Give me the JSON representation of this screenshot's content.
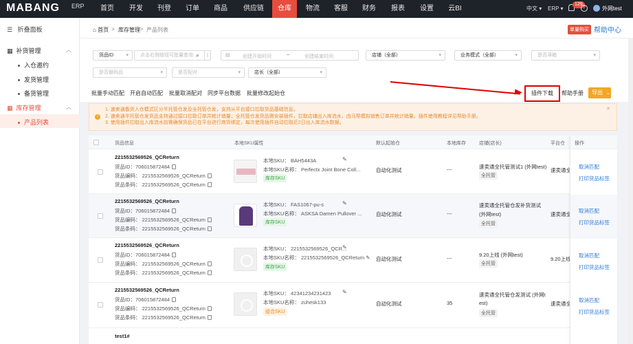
{
  "brand": {
    "logo": "MABANG",
    "erp": "ERP"
  },
  "nav": [
    "首页",
    "开发",
    "刊登",
    "订单",
    "商品",
    "供应链",
    "仓库",
    "物流",
    "客服",
    "财务",
    "报表",
    "设置",
    "云BI"
  ],
  "topright": {
    "lang": "中文",
    "erp": "ERP",
    "badge": "129",
    "user": "外网test"
  },
  "sidebar": {
    "fold": "折叠面板",
    "groups": [
      {
        "label": "补货管理",
        "items": [
          "入仓邀约",
          "发货管理",
          "备货管理"
        ]
      },
      {
        "label": "库存管理",
        "items": [
          "产品列表"
        ]
      }
    ]
  },
  "breadcrumb": {
    "home": "首页",
    "level1": "库存管理",
    "level2": "产品列表"
  },
  "header_actions": {
    "buy": "单量购买",
    "help_center": "帮助中心"
  },
  "filters": {
    "goods_id": "货品ID",
    "search_placeholder": "点击右侧按钮可批量查询",
    "start_time": "创建开始时间",
    "tilde": "~",
    "end_time": "创建结束时间",
    "shop": "店铺（全部）",
    "biz_mode": "业务模式（全部）",
    "is_collect": "是否滞箱",
    "is_replace": "是否替码品",
    "is_paired": "是否配对",
    "shop_owner": "店长（全部）"
  },
  "actions": {
    "batch_match": "批量手动匹配",
    "auto_match": "开启自动匹配",
    "batch_unpair": "批量取消配对",
    "sync_platform": "同步平台数据",
    "batch_edit": "批量修改起始仓",
    "plugin_download": "插件下载",
    "manual": "帮助手册",
    "export": "导出"
  },
  "notice": [
    "1. 速卖通备货入仓模式区分半托管仓发及全托管仓发，支持从平台接口拉取货品基础信息。",
    "2. 速卖通半托管仓发货品支持通过接口拉取订单并统计销量；全托管仓发货品需安装插件，拉取店铺出入库流水，由马帮模拟销售订单并统计销量。插件使用教程详见帮助手册。",
    "3. 使用插件拉取出入库流水前需确保货品已在平台进行商货绑定，每次使用插件自动拉取近2日出入库流水数据。"
  ],
  "table": {
    "headers": [
      "货品信息",
      "本地SKU属性",
      "默认起始仓",
      "本地库存",
      "店铺(店长)",
      "平台仓",
      "操作"
    ],
    "labels": {
      "goods_id": "货品ID：",
      "goods_code": "货品编码：",
      "goods_barcode": "货品条码：",
      "local_sku": "本地SKU：",
      "local_sku_name": "本地SKU名称："
    },
    "rows": [
      {
        "title": "2215532569526_QCReturn",
        "goods_id": "706015872484",
        "code": "2215532569526_QCReturn",
        "barcode": "2215532569526_QCReturn",
        "sku": "BAH5443A",
        "sku_name": "Perfectx Joint Bone Coll...",
        "sku_tag": "库存SKU",
        "warehouse": "自动化测试",
        "stock": "---",
        "shop": "速卖通全托管测试1 (外网test)",
        "shop2": "",
        "mode": "全托管",
        "platform": "速卖通全"
      },
      {
        "title": "2215532569526_QCReturn",
        "goods_id": "706015872484",
        "code": "2215532569526_QCReturn",
        "barcode": "2215532569526_QCReturn",
        "sku": "FAS1067-pu-s",
        "sku_name": "ASKSA Damen Pullover ...",
        "sku_tag": "库存SKU",
        "warehouse": "自动化测试",
        "stock": "---",
        "shop": "速卖通全托管仓发补货测试",
        "shop2": "(外网test)",
        "mode": "全托管",
        "platform": "速卖通全"
      },
      {
        "title": "2215532569526_QCReturn",
        "goods_id": "706015872484",
        "code": "2215532569526_QCReturn",
        "barcode": "2215532569526_QCReturn",
        "sku": "2215532569526_QCR...",
        "sku_name": "2215532569526_QCReturn",
        "sku_tag": "库存SKU",
        "warehouse": "自动化测试",
        "stock": "---",
        "shop": "9.20上线 (外网test)",
        "shop2": "",
        "mode": "全托管",
        "platform": "9.20上线"
      },
      {
        "title": "2215532569526_QCReturn",
        "goods_id": "706015872484",
        "code": "2215532569526_QCReturn",
        "barcode": "2215532569526_QCReturn",
        "sku": "42341234231423",
        "sku_name": "zuhesk133",
        "sku_tag": "组合SKU",
        "warehouse": "自动化测试",
        "stock": "35",
        "shop": "速卖通全托管仓发测试 (外网t",
        "shop2": "est)",
        "mode": "全托管",
        "platform": "速卖通全"
      }
    ],
    "partial_row": "test1#",
    "ops": [
      "取消匹配",
      "打印货品标签"
    ]
  }
}
